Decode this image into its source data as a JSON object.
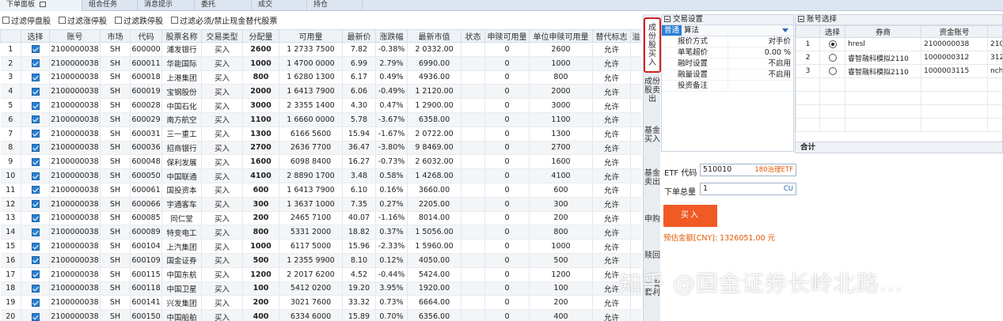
{
  "top_tabs": [
    "下单面板",
    "组合任务",
    "消息提示",
    "委托",
    "成交",
    "持仓"
  ],
  "filters": [
    "过滤停盘股",
    "过滤涨停股",
    "过滤跌停股",
    "过滤必须/禁止现金替代股票"
  ],
  "table": {
    "headers": [
      "",
      "选择",
      "账号",
      "市场",
      "代码",
      "股票名称",
      "交易类型",
      "分配量",
      "可用量",
      "最新价",
      "涨跌幅",
      "最新市值",
      "状态",
      "申赎可用量",
      "单位申赎可用量",
      "替代标志",
      "溢"
    ],
    "rows": [
      {
        "n": "1",
        "acct": "2100000038",
        "mkt": "SH",
        "code": "600000",
        "name": "浦发银行",
        "type": "买入",
        "alloc": "2600",
        "avail": "1 2733 7500",
        "price": "7.82",
        "chg": "-0.38%",
        "dir": "down",
        "mv": "2 0332.00",
        "status": "",
        "redeem": "0",
        "unit": "2600",
        "flag": "允许"
      },
      {
        "n": "2",
        "acct": "2100000038",
        "mkt": "SH",
        "code": "600011",
        "name": "华能国际",
        "type": "买入",
        "alloc": "1000",
        "avail": "1 4700 0000",
        "price": "6.99",
        "chg": "2.79%",
        "dir": "up",
        "mv": "6990.00",
        "status": "",
        "redeem": "0",
        "unit": "1000",
        "flag": "允许"
      },
      {
        "n": "3",
        "acct": "2100000038",
        "mkt": "SH",
        "code": "600018",
        "name": "上港集团",
        "type": "买入",
        "alloc": "800",
        "avail": "1 6280 1300",
        "price": "6.17",
        "chg": "0.49%",
        "dir": "up",
        "mv": "4936.00",
        "status": "",
        "redeem": "0",
        "unit": "800",
        "flag": "允许"
      },
      {
        "n": "4",
        "acct": "2100000038",
        "mkt": "SH",
        "code": "600019",
        "name": "宝钢股份",
        "type": "买入",
        "alloc": "2000",
        "avail": "1 6413 7900",
        "price": "6.06",
        "chg": "-0.49%",
        "dir": "down",
        "mv": "1 2120.00",
        "status": "",
        "redeem": "0",
        "unit": "2000",
        "flag": "允许"
      },
      {
        "n": "5",
        "acct": "2100000038",
        "mkt": "SH",
        "code": "600028",
        "name": "中国石化",
        "type": "买入",
        "alloc": "3000",
        "avail": "2 3355 1400",
        "price": "4.30",
        "chg": "0.47%",
        "dir": "up",
        "mv": "1 2900.00",
        "status": "",
        "redeem": "0",
        "unit": "3000",
        "flag": "允许"
      },
      {
        "n": "6",
        "acct": "2100000038",
        "mkt": "SH",
        "code": "600029",
        "name": "南方航空",
        "type": "买入",
        "alloc": "1100",
        "avail": "1 6660 0000",
        "price": "5.78",
        "chg": "-3.67%",
        "dir": "down",
        "mv": "6358.00",
        "status": "",
        "redeem": "0",
        "unit": "1100",
        "flag": "允许"
      },
      {
        "n": "7",
        "acct": "2100000038",
        "mkt": "SH",
        "code": "600031",
        "name": "三一重工",
        "type": "买入",
        "alloc": "1300",
        "avail": "6166 5600",
        "price": "15.94",
        "chg": "-1.67%",
        "dir": "down",
        "mv": "2 0722.00",
        "status": "",
        "redeem": "0",
        "unit": "1300",
        "flag": "允许"
      },
      {
        "n": "8",
        "acct": "2100000038",
        "mkt": "SH",
        "code": "600036",
        "name": "招商银行",
        "type": "买入",
        "alloc": "2700",
        "avail": "2636 7700",
        "price": "36.47",
        "chg": "-3.80%",
        "dir": "down",
        "mv": "9 8469.00",
        "status": "",
        "redeem": "0",
        "unit": "2700",
        "flag": "允许"
      },
      {
        "n": "9",
        "acct": "2100000038",
        "mkt": "SH",
        "code": "600048",
        "name": "保利发展",
        "type": "买入",
        "alloc": "1600",
        "avail": "6098 8400",
        "price": "16.27",
        "chg": "-0.73%",
        "dir": "down",
        "mv": "2 6032.00",
        "status": "",
        "redeem": "0",
        "unit": "1600",
        "flag": "允许"
      },
      {
        "n": "10",
        "acct": "2100000038",
        "mkt": "SH",
        "code": "600050",
        "name": "中国联通",
        "type": "买入",
        "alloc": "4100",
        "avail": "2 8890 1700",
        "price": "3.48",
        "chg": "0.58%",
        "dir": "up",
        "mv": "1 4268.00",
        "status": "",
        "redeem": "0",
        "unit": "4100",
        "flag": "允许"
      },
      {
        "n": "11",
        "acct": "2100000038",
        "mkt": "SH",
        "code": "600061",
        "name": "国投资本",
        "type": "买入",
        "alloc": "600",
        "avail": "1 6413 7900",
        "price": "6.10",
        "chg": "0.16%",
        "dir": "up",
        "mv": "3660.00",
        "status": "",
        "redeem": "0",
        "unit": "600",
        "flag": "允许"
      },
      {
        "n": "12",
        "acct": "2100000038",
        "mkt": "SH",
        "code": "600066",
        "name": "宇通客车",
        "type": "买入",
        "alloc": "300",
        "avail": "1 3637 1000",
        "price": "7.35",
        "chg": "0.27%",
        "dir": "up",
        "mv": "2205.00",
        "status": "",
        "redeem": "0",
        "unit": "300",
        "flag": "允许"
      },
      {
        "n": "13",
        "acct": "2100000038",
        "mkt": "SH",
        "code": "600085",
        "name": "同仁堂",
        "type": "买入",
        "alloc": "200",
        "avail": "2465 7100",
        "price": "40.07",
        "chg": "-1.16%",
        "dir": "down",
        "mv": "8014.00",
        "status": "",
        "redeem": "0",
        "unit": "200",
        "flag": "允许"
      },
      {
        "n": "14",
        "acct": "2100000038",
        "mkt": "SH",
        "code": "600089",
        "name": "特变电工",
        "type": "买入",
        "alloc": "800",
        "avail": "5331 2000",
        "price": "18.82",
        "chg": "0.37%",
        "dir": "up",
        "mv": "1 5056.00",
        "status": "",
        "redeem": "0",
        "unit": "800",
        "flag": "允许"
      },
      {
        "n": "15",
        "acct": "2100000038",
        "mkt": "SH",
        "code": "600104",
        "name": "上汽集团",
        "type": "买入",
        "alloc": "1000",
        "avail": "6117 5000",
        "price": "15.96",
        "chg": "-2.33%",
        "dir": "down",
        "mv": "1 5960.00",
        "status": "",
        "redeem": "0",
        "unit": "1000",
        "flag": "允许"
      },
      {
        "n": "16",
        "acct": "2100000038",
        "mkt": "SH",
        "code": "600109",
        "name": "国金证券",
        "type": "买入",
        "alloc": "500",
        "avail": "1 2355 9900",
        "price": "8.10",
        "chg": "0.12%",
        "dir": "up",
        "mv": "4050.00",
        "status": "",
        "redeem": "0",
        "unit": "500",
        "flag": "允许"
      },
      {
        "n": "17",
        "acct": "2100000038",
        "mkt": "SH",
        "code": "600115",
        "name": "中国东航",
        "type": "买入",
        "alloc": "1200",
        "avail": "2 2017 6200",
        "price": "4.52",
        "chg": "-0.44%",
        "dir": "down",
        "mv": "5424.00",
        "status": "",
        "redeem": "0",
        "unit": "1200",
        "flag": "允许"
      },
      {
        "n": "18",
        "acct": "2100000038",
        "mkt": "SH",
        "code": "600118",
        "name": "中国卫星",
        "type": "买入",
        "alloc": "100",
        "avail": "5412 0200",
        "price": "19.20",
        "chg": "3.95%",
        "dir": "up",
        "mv": "1920.00",
        "status": "",
        "redeem": "0",
        "unit": "100",
        "flag": "允许"
      },
      {
        "n": "19",
        "acct": "2100000038",
        "mkt": "SH",
        "code": "600141",
        "name": "兴发集团",
        "type": "买入",
        "alloc": "200",
        "avail": "3021 7600",
        "price": "33.32",
        "chg": "0.73%",
        "dir": "up",
        "mv": "6664.00",
        "status": "",
        "redeem": "0",
        "unit": "200",
        "flag": "允许"
      },
      {
        "n": "20",
        "acct": "2100000038",
        "mkt": "SH",
        "code": "600150",
        "name": "中国船舶",
        "type": "买入",
        "alloc": "400",
        "avail": "6334 6000",
        "price": "15.89",
        "chg": "0.70%",
        "dir": "up",
        "mv": "6356.00",
        "status": "",
        "redeem": "0",
        "unit": "400",
        "flag": "允许"
      }
    ]
  },
  "side_tabs": [
    "成份股买入",
    "成份股卖出",
    "基金买入",
    "基金卖出",
    "申购",
    "赎回",
    "一键套利"
  ],
  "settings": {
    "title": "交易设置",
    "subtabs": [
      "普通",
      "算法"
    ],
    "props": [
      {
        "k": "报价方式",
        "v": "对手价"
      },
      {
        "k": "单笔超价",
        "v": "0.00 %"
      },
      {
        "k": "融时设置",
        "v": "不启用"
      },
      {
        "k": "融量设置",
        "v": "不启用"
      },
      {
        "k": "投资备注",
        "v": ""
      }
    ]
  },
  "account": {
    "title": "账号选择",
    "headers": [
      "",
      "选择",
      "券商",
      "资金账号",
      "账号"
    ],
    "rows": [
      {
        "n": "1",
        "selected": true,
        "broker": "hresl",
        "fund": "2100000038",
        "acct": "2100000"
      },
      {
        "n": "2",
        "selected": false,
        "broker": "睿智融科模拟2110",
        "fund": "1000000312",
        "acct": "312"
      },
      {
        "n": "3",
        "selected": false,
        "broker": "睿智融科模拟2110",
        "fund": "1000003115",
        "acct": "nch"
      }
    ],
    "total_label": "合计"
  },
  "order": {
    "etf_label": "ETF 代码",
    "etf_value": "510010",
    "etf_suffix": "180治理ETF",
    "qty_label": "下单总量",
    "qty_value": "1",
    "qty_suffix": "CU",
    "buy_label": "买入",
    "estimate": "预估金额[CNY]: 1326051.00 元"
  },
  "watermark": "知乎 @国金证券长岭北路..."
}
